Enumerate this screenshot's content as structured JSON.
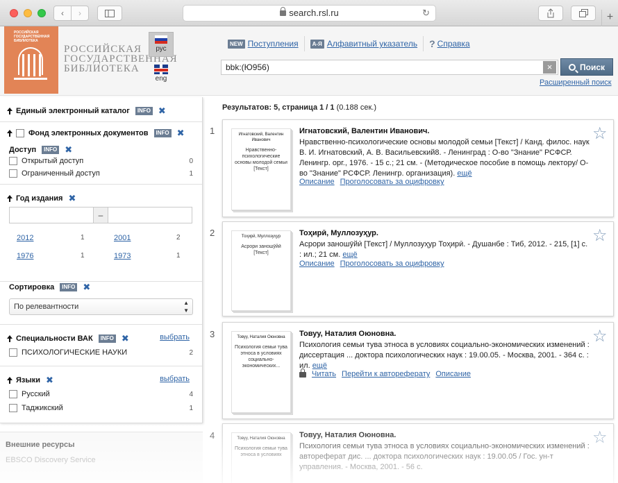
{
  "browser": {
    "url": "search.rsl.ru"
  },
  "header": {
    "logo_small_text": "РОССИЙСКАЯ ГОСУДАРСТВЕННАЯ БИБЛИОТЕКА",
    "logo_line1": "РОССИЙСКАЯ",
    "logo_line2": "ГОСУДАРСТВЕННАЯ",
    "logo_line3": "БИБЛИОТЕКА",
    "lang_ru": "рус",
    "lang_en": "eng",
    "nav": [
      {
        "tag": "NEW",
        "label": "Поступления"
      },
      {
        "tag": "А-Я",
        "label": "Алфавитный указатель"
      },
      {
        "tag": "?",
        "label": "Справка"
      }
    ],
    "search_value": "bbk:(Ю956)",
    "search_button": "Поиск",
    "advanced_search": "Расширенный поиск"
  },
  "sidebar": {
    "info_label": "INFO",
    "catalog": "Единый электронный каталог",
    "fund": "Фонд электронных документов",
    "access": {
      "title": "Доступ",
      "items": [
        {
          "label": "Открытый доступ",
          "count": "0"
        },
        {
          "label": "Ограниченный доступ",
          "count": "1"
        }
      ]
    },
    "year": {
      "title": "Год издания",
      "dash": "–",
      "items": [
        {
          "label": "2012",
          "count": "1"
        },
        {
          "label": "2001",
          "count": "2"
        },
        {
          "label": "1976",
          "count": "1"
        },
        {
          "label": "1973",
          "count": "1"
        }
      ]
    },
    "sort": {
      "title": "Сортировка",
      "value": "По релевантности"
    },
    "vak": {
      "title": "Специальности ВАК",
      "choose": "выбрать",
      "items": [
        {
          "label": "ПСИХОЛОГИЧЕСКИЕ НАУКИ",
          "count": "2"
        }
      ]
    },
    "languages": {
      "title": "Языки",
      "choose": "выбрать",
      "items": [
        {
          "label": "Русский",
          "count": "4"
        },
        {
          "label": "Таджикский",
          "count": "1"
        }
      ]
    },
    "external": {
      "title": "Внешние ресурсы",
      "item": "EBSCO Discovery Service"
    }
  },
  "results": {
    "summary_bold": "Результатов: 5, страница 1 / 1",
    "summary_time": "(0.188 сек.)",
    "more": "ещё",
    "items": [
      {
        "num": "1",
        "cover_author": "Игнатовский, Валентин Иванович",
        "cover_title": "Нравственно-психологические основы молодой семьи [Текст]",
        "author": "Игнатовский, Валентин Иванович.",
        "desc": "Нравственно-психологические основы молодой семьи [Текст] / Канд. филос. наук В. И. Игнатовский, А. В. Васильевский8. - Ленинград : О-во \"Знание\" РСФСР. Ленингр. орг., 1976. - 15 с.; 21 см. - (Методическое пособие в помощь лектору/ О-во \"Знание\" РСФСР. Ленингр. организация).",
        "links": [
          "Описание",
          "Проголосовать за оцифровку"
        ]
      },
      {
        "num": "2",
        "cover_author": "Тоҳирӣ, Муллозуҳур",
        "cover_title": "Асрори заношӯйӣ [Текст]",
        "author": "Тоҳирӣ, Муллозуҳур.",
        "desc": "Асрори заношӯйӣ [Текст] / Муллозуҳур Тоҳирӣ. - Душанбе : Тиб, 2012. - 215, [1] с. : ил.; 21 см.",
        "links": [
          "Описание",
          "Проголосовать за оцифровку"
        ]
      },
      {
        "num": "3",
        "cover_author": "Товуу, Наталия Оюновна",
        "cover_title": "Психология семьи тува этноса в условиях социально-экономических...",
        "author": "Товуу, Наталия Оюновна.",
        "desc": "Психология семьи тува этноса в условиях социально-экономических изменений : диссертация ... доктора психологических наук : 19.00.05. - Москва, 2001. - 364 с. : ил.",
        "links": [
          "Читать",
          "Перейти к автореферату",
          "Описание"
        ]
      },
      {
        "num": "4",
        "cover_author": "Товуу, Наталия Оюновна",
        "cover_title": "Психология семьи тува этноса в условиях",
        "author": "Товуу, Наталия Оюновна.",
        "desc": "Психология семьи тува этноса в условиях социально-экономических изменений : автореферат дис. ... доктора психологических наук : 19.00.05 / Гос. ун-т управления. - Москва, 2001. - 56 с.",
        "links": []
      }
    ]
  }
}
